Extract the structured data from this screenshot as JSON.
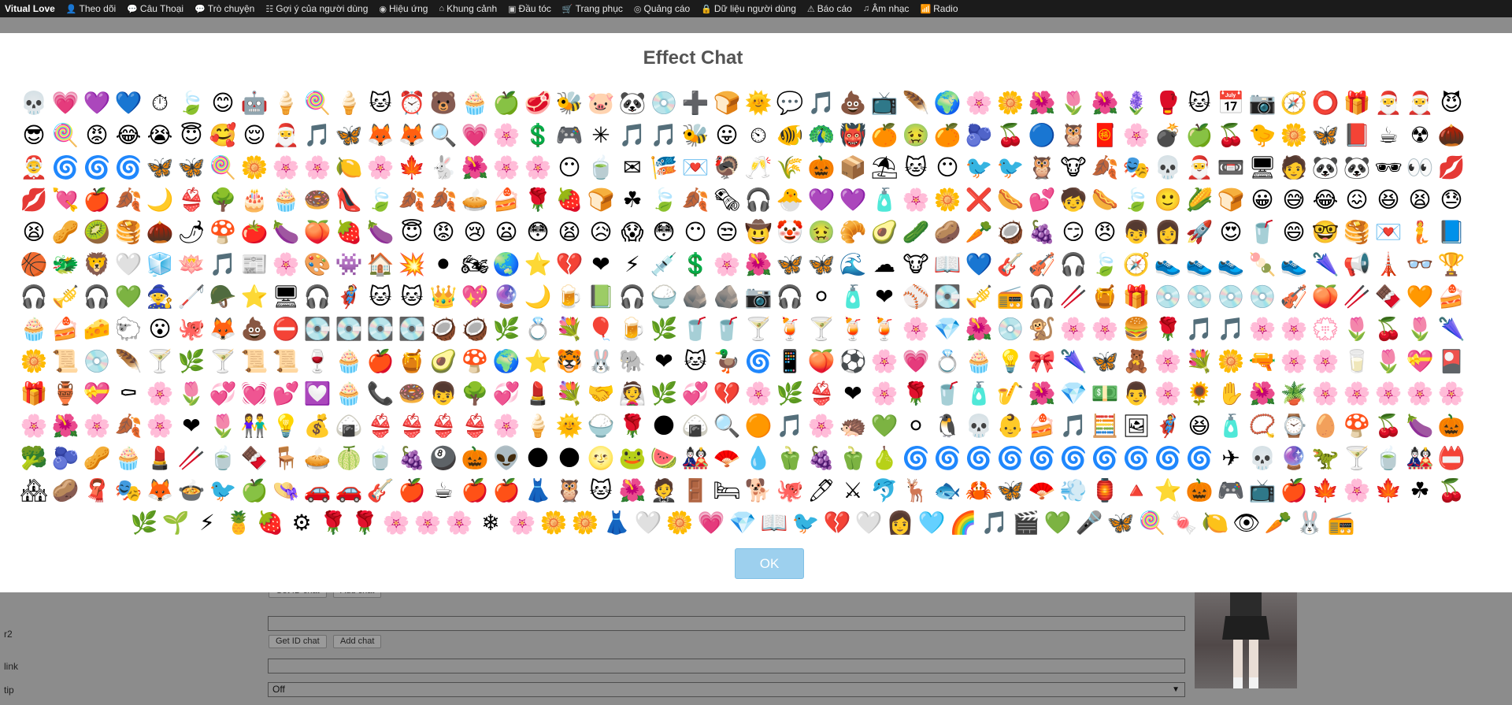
{
  "navbar": {
    "brand": "Vitual Love",
    "items": [
      {
        "label": "Theo dõi",
        "icon": "👤"
      },
      {
        "label": "Câu Thoại",
        "icon": "💬"
      },
      {
        "label": "Trò chuyện",
        "icon": "💬"
      },
      {
        "label": "Gợi ý của người dùng",
        "icon": "☷"
      },
      {
        "label": "Hiệu ứng",
        "icon": "◉"
      },
      {
        "label": "Khung cảnh",
        "icon": "⌂"
      },
      {
        "label": "Đầu tóc",
        "icon": "▣"
      },
      {
        "label": "Trang phục",
        "icon": "🛒"
      },
      {
        "label": "Quảng cáo",
        "icon": "◎"
      },
      {
        "label": "Dữ liệu người dùng",
        "icon": "🔒"
      },
      {
        "label": "Báo cáo",
        "icon": "⚠"
      },
      {
        "label": "Âm nhạc",
        "icon": "♫"
      },
      {
        "label": "Radio",
        "icon": "📶"
      }
    ]
  },
  "form": {
    "row1": {
      "get_id": "Get ID chat",
      "add_chat": "Add chat"
    },
    "row2": {
      "label": "r2",
      "get_id": "Get ID chat",
      "add_chat": "Add chat"
    },
    "link": {
      "label": "link"
    },
    "tip": {
      "label": "tip",
      "value": "Off"
    }
  },
  "modal": {
    "title": "Effect Chat",
    "ok_label": "OK",
    "effects": [
      "💀",
      "💗",
      "💜",
      "💙",
      "⏱",
      "🍃",
      "😊",
      "🤖",
      "🍦",
      "🍭",
      "🍦",
      "🐱",
      "⏰",
      "🐻",
      "🧁",
      "🍏",
      "🥩",
      "🐝",
      "🐷",
      "🐼",
      "💿",
      "➕",
      "🍞",
      "🌞",
      "💬",
      "🎵",
      "💩",
      "📺",
      "🪶",
      "🌍",
      "🌸",
      "🌼",
      "🌺",
      "🌷",
      "🌺",
      "🪻",
      "🥊",
      "🐱",
      "📅",
      "📷",
      "🧭",
      "⭕",
      "🎁",
      "🎅",
      "🎅",
      "😈",
      "😎",
      "🍭",
      "😡",
      "😂",
      "😭",
      "😇",
      "🥰",
      "😌",
      "🎅",
      "🎵",
      "🦋",
      "🦊",
      "🦊",
      "🔍",
      "💗",
      "🌸",
      "💲",
      "🎮",
      "✳",
      "🎵",
      "🎵",
      "🐝",
      "😛",
      "⏲",
      "🐠",
      "🦚",
      "👹",
      "🍊",
      "🤢",
      "🍊",
      "🫐",
      "🍒",
      "🔵",
      "🦉",
      "🧧",
      "🌸",
      "💣",
      "🍏",
      "🍒",
      "🐤",
      "🌼",
      "🦋",
      "📕",
      "☕",
      "☢",
      "🌰",
      "🤶",
      "🌀",
      "🌀",
      "🌀",
      "🦋",
      "🦋",
      "🍭",
      "🌼",
      "🌸",
      "🌸",
      "🍋",
      "🌸",
      "🍁",
      "🐇",
      "🌺",
      "🌸",
      "🌸",
      "😶",
      "🍵",
      "✉",
      "🎏",
      "💌",
      "🦃",
      "🥂",
      "🌾",
      "🎃",
      "📦",
      "⛱",
      "🐱",
      "😶",
      "🐦",
      "🐦",
      "🦉",
      "🐮",
      "🍂",
      "🎭",
      "💀",
      "🎅",
      "📼",
      "🖥",
      "🧑",
      "🐼",
      "🐼",
      "🕶",
      "👀",
      "💋",
      "💋",
      "💘",
      "🍎",
      "🍂",
      "🌙",
      "👙",
      "🌳",
      "🎂",
      "🧁",
      "🍩",
      "👠",
      "🍃",
      "🍂",
      "🍂",
      "🥧",
      "🍰",
      "🌹",
      "🍓",
      "🍞",
      "☘",
      "🍃",
      "🍂",
      "🗞",
      "🎧",
      "🐣",
      "💜",
      "💜",
      "🧴",
      "🌸",
      "🌼",
      "❌",
      "🌭",
      "💕",
      "🧒",
      "🌭",
      "🍃",
      "🙂",
      "🌽",
      "🍞",
      "😀",
      "😅",
      "😂",
      "😖",
      "😆",
      "😫",
      "😓",
      "😫",
      "🥜",
      "🥝",
      "🥞",
      "🌰",
      "🌶",
      "🍄",
      "🍅",
      "🍆",
      "🍑",
      "🍓",
      "🍆",
      "😇",
      "😡",
      "😢",
      "😦",
      "😳",
      "😫",
      "😥",
      "😱",
      "😳",
      "😶",
      "😒",
      "🤠",
      "🤡",
      "🤢",
      "🥐",
      "🥑",
      "🥒",
      "🥔",
      "🥕",
      "🥥",
      "🍇",
      "😏",
      "😠",
      "👦",
      "👩",
      "🚀",
      "😍",
      "🥤",
      "😄",
      "🤓",
      "🥞",
      "💌",
      "🧜",
      "📘",
      "🏀",
      "🐲",
      "🦁",
      "🤍",
      "🧊",
      "🪷",
      "🎵",
      "📰",
      "🌸",
      "🎨",
      "👾",
      "🏠",
      "💥",
      "⚫",
      "🏍",
      "🌏",
      "⭐",
      "💔",
      "❤",
      "⚡",
      "💉",
      "💲",
      "🌸",
      "🌺",
      "🦋",
      "🦋",
      "🌊",
      "☁",
      "🐮",
      "📖",
      "💙",
      "🎸",
      "🎻",
      "🎧",
      "🍃",
      "🧭",
      "👟",
      "👟",
      "👟",
      "🍡",
      "👟",
      "🌂",
      "📢",
      "🗼",
      "👓",
      "🏆",
      "🎧",
      "🎺",
      "🎧",
      "💚",
      "🧙",
      "🦯",
      "🪖",
      "⭐",
      "🖥",
      "🎧",
      "🦸",
      "🐱",
      "🐱",
      "👑",
      "💖",
      "🔮",
      "🌙",
      "🍺",
      "📗",
      "🎧",
      "🍚",
      "🪨",
      "🪨",
      "📷",
      "🎧",
      "⚪",
      "🧴",
      "❤",
      "⚾",
      "💽",
      "🎺",
      "📻",
      "🎧",
      "🥢",
      "🍯",
      "🎁",
      "💿",
      "💿",
      "💿",
      "💿",
      "🎻",
      "🍑",
      "🥢",
      "🍫",
      "🧡",
      "🍰",
      "🧁",
      "🍰",
      "🧀",
      "🐑",
      "😮",
      "🐙",
      "🦊",
      "💩",
      "⛔",
      "💽",
      "💽",
      "💽",
      "💽",
      "🥥",
      "🥥",
      "🌿",
      "💍",
      "💐",
      "🎈",
      "🍺",
      "🌿",
      "🥤",
      "🥤",
      "🍸",
      "🍹",
      "🍸",
      "🍹",
      "🍹",
      "🌸",
      "💎",
      "🌺",
      "💿",
      "🐒",
      "🌸",
      "🌸",
      "🍔",
      "🌹",
      "🎵",
      "🎵",
      "🌸",
      "🌸",
      "💮",
      "🌷",
      "🍒",
      "🌷",
      "🌂",
      "🌼",
      "📜",
      "💿",
      "🪶",
      "🍸",
      "🌿",
      "🍸",
      "📜",
      "📜",
      "🍷",
      "🧁",
      "🍎",
      "🍯",
      "🥑",
      "🍄",
      "🌍",
      "⭐",
      "🐯",
      "🐰",
      "🐘",
      "❤",
      "🐱",
      "🦆",
      "🌀",
      "📱",
      "🍑",
      "⚽",
      "🌸",
      "💗",
      "💍",
      "🧁",
      "💡",
      "🎀",
      "🌂",
      "🦋",
      "🧸",
      "🌸",
      "💐",
      "🌼",
      "🔫",
      "🌸",
      "🌸",
      "🥛",
      "🌷",
      "💝",
      "🎴",
      "🎁",
      "🏺",
      "💝",
      "⚰",
      "🌸",
      "🌷",
      "💞",
      "💓",
      "💕",
      "💟",
      "🧁",
      "📞",
      "🍩",
      "👦",
      "🌳",
      "💞",
      "💄",
      "💐",
      "🤝",
      "👰",
      "🌿",
      "💞",
      "💔",
      "🌸",
      "🌿",
      "👙",
      "❤",
      "🌸",
      "🌹",
      "🥤",
      "🧴",
      "🎷",
      "🌺",
      "💎",
      "💵",
      "👨",
      "🌸",
      "🌻",
      "✋",
      "🌺",
      "🪴",
      "🌸",
      "🌸",
      "🌸",
      "🌸",
      "🌸",
      "🌸",
      "🌺",
      "🌸",
      "🍂",
      "🌸",
      "❤",
      "🌷",
      "👫",
      "💡",
      "💰",
      "🍙",
      "👙",
      "👙",
      "👙",
      "👙",
      "🌸",
      "🍦",
      "🌞",
      "🍚",
      "🌹",
      "🌑",
      "🍙",
      "🔍",
      "🟠",
      "🎵",
      "🌸",
      "🦔",
      "💚",
      "⚪",
      "🐧",
      "💀",
      "👶",
      "🍰",
      "🎵",
      "🧮",
      "🖼",
      "🦸",
      "😆",
      "🧴",
      "📿",
      "⌚",
      "🥚",
      "🍄",
      "🍒",
      "🍆",
      "🎃",
      "🥦",
      "🫐",
      "🥜",
      "🧁",
      "💄",
      "🥢",
      "🍵",
      "🍫",
      "🪑",
      "🥧",
      "🍈",
      "🍵",
      "🍇",
      "🎱",
      "🎃",
      "👽",
      "🌑",
      "🌑",
      "🌝",
      "🐸",
      "🍉",
      "🎎",
      "🪭",
      "💧",
      "🫑",
      "🍇",
      "🫑",
      "🍐",
      "🌀",
      "🌀",
      "🌀",
      "🌀",
      "🌀",
      "🌀",
      "🌀",
      "🌀",
      "🌀",
      "🌀",
      "✈",
      "💀",
      "🔮",
      "🦖",
      "🍸",
      "🍵",
      "🎎",
      "📛",
      "🏘",
      "🥔",
      "🧣",
      "🎭",
      "🦊",
      "🍲",
      "🐦",
      "🍏",
      "👒",
      "🚗",
      "🚗",
      "🎸",
      "🍎",
      "☕",
      "🍎",
      "🍎",
      "👗",
      "🦉",
      "🐱",
      "🌺",
      "🤵",
      "🚪",
      "🛏",
      "🐕",
      "🐙",
      "🖊",
      "⚔",
      "🐬",
      "🦌",
      "🐟",
      "🦀",
      "🦋",
      "🪭",
      "💨",
      "🏮",
      "🔺",
      "⭐",
      "🎃",
      "🎮",
      "📺",
      "🍎",
      "🍁",
      "🌸",
      "🍁",
      "☘",
      "🍒",
      "🌿",
      "🌱",
      "⚡",
      "🍍",
      "🍓",
      "⚙",
      "🌹",
      "🌹",
      "🌸",
      "🌸",
      "🌸",
      "❄",
      "🌸",
      "🌼",
      "🌼",
      "👗",
      "🤍",
      "🌼",
      "💗",
      "💎",
      "📖",
      "🐦",
      "💔",
      "🤍",
      "👩",
      "🩵",
      "🌈",
      "🎵",
      "🎬",
      "💚",
      "🎤",
      "🦋",
      "🍭",
      "🍬",
      "🍋",
      "👁",
      "🥕",
      "🐰",
      "📻"
    ]
  }
}
